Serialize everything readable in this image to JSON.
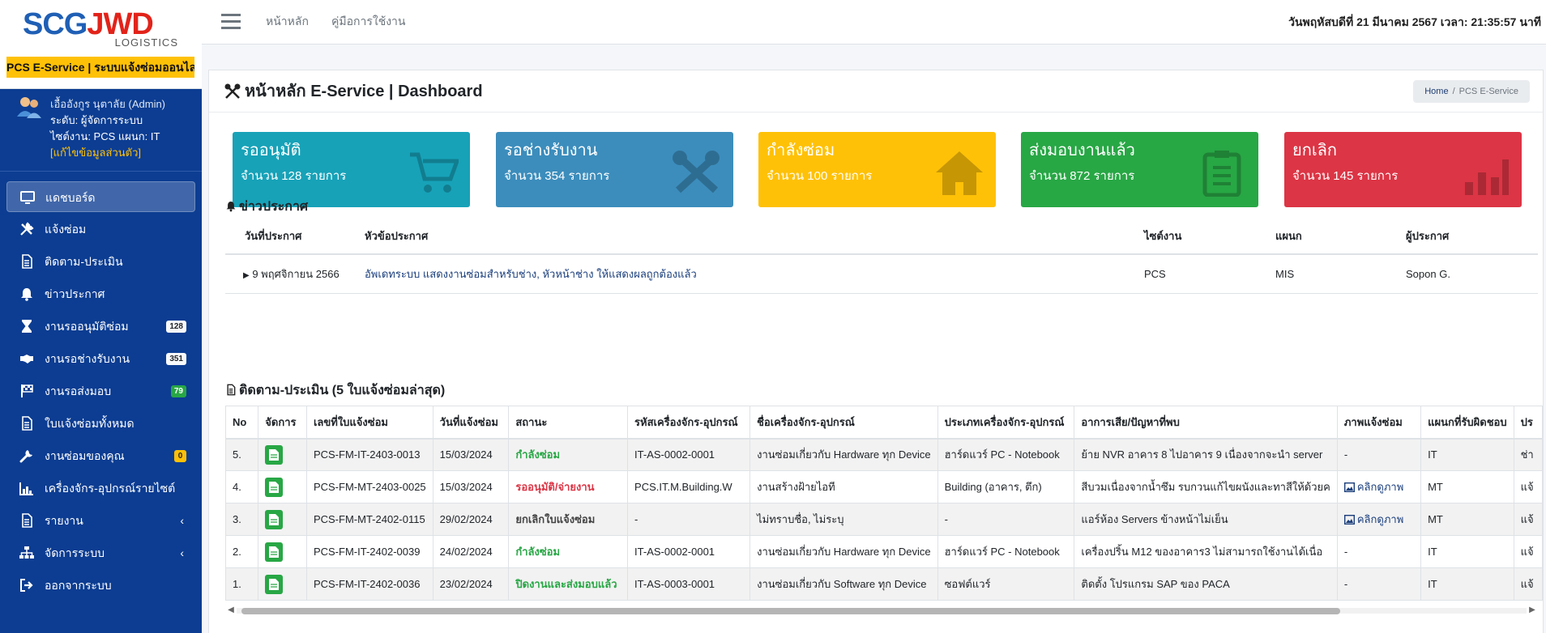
{
  "brand": {
    "logo_text_left": "SCG",
    "logo_text_right": "JWD",
    "logo_sub": "LOGISTICS",
    "band": "PCS E-Service | ระบบแจ้งซ่อมออนไลน์"
  },
  "user": {
    "name": "เอื้ออังกูร นุตาลัย (Admin)",
    "level": "ระดับ: ผู้จัดการระบบ",
    "site": "ไซต์งาน: PCS แผนก: IT",
    "edit_link": "[แก้ไขข้อมูลส่วนตัว]"
  },
  "nav": {
    "items": [
      {
        "label": "แดชบอร์ด",
        "icon": "desktop-icon"
      },
      {
        "label": "แจ้งซ่อม",
        "icon": "tools-icon"
      },
      {
        "label": "ติดตาม-ประเมิน",
        "icon": "file-icon"
      },
      {
        "label": "ข่าวประกาศ",
        "icon": "bell-icon"
      },
      {
        "label": "งานรออนุมัติซ่อม",
        "icon": "hourglass-icon",
        "badge": "128"
      },
      {
        "label": "งานรอช่างรับงาน",
        "icon": "handshake-icon",
        "badge": "351"
      },
      {
        "label": "งานรอส่งมอบ",
        "icon": "flag-icon",
        "badge": "79"
      },
      {
        "label": "ใบแจ้งซ่อมทั้งหมด",
        "icon": "file-icon"
      },
      {
        "label": "งานซ่อมของคุณ",
        "icon": "wrench-icon",
        "badge": "0"
      },
      {
        "label": "เครื่องจักร-อุปกรณ์รายไซต์",
        "icon": "chart-icon"
      },
      {
        "label": "รายงาน",
        "icon": "file-icon",
        "chevron": "‹"
      },
      {
        "label": "จัดการระบบ",
        "icon": "sitemap-icon",
        "chevron": "‹"
      },
      {
        "label": "ออกจากระบบ",
        "icon": "signout-icon"
      }
    ]
  },
  "topbar": {
    "home_link": "หน้าหลัก",
    "manual_link": "คู่มือการใช้งาน",
    "datetime": "วันพฤหัสบดีที่ 21 มีนาคม 2567 เวลา: 21:35:57 นาที"
  },
  "page": {
    "title": "หน้าหลัก E-Service | Dashboard",
    "breadcrumb_home": "Home",
    "breadcrumb_sep": "/",
    "breadcrumb_current": "PCS E-Service"
  },
  "stats": [
    {
      "title": "รออนุมัติ",
      "count": "จำนวน 128 รายการ",
      "color": "#17a2b8",
      "icon": "cart-icon"
    },
    {
      "title": "รอช่างรับงาน",
      "count": "จำนวน 354 รายการ",
      "color": "#3c8dbc",
      "icon": "tools-icon"
    },
    {
      "title": "กำลังซ่อม",
      "count": "จำนวน 100 รายการ",
      "color": "#ffc107",
      "icon": "home-icon"
    },
    {
      "title": "ส่งมอบงานแล้ว",
      "count": "จำนวน 872 รายการ",
      "color": "#28a745",
      "icon": "clipboard-icon"
    },
    {
      "title": "ยกเลิก",
      "count": "จำนวน 145 รายการ",
      "color": "#dc3545",
      "icon": "bar-chart-icon"
    }
  ],
  "announcements": {
    "title": "ข่าวประกาศ",
    "headers": [
      "วันที่ประกาศ",
      "หัวข้อประกาศ",
      "ไซต์งาน",
      "แผนก",
      "ผู้ประกาศ"
    ],
    "rows": [
      {
        "date": "9 พฤศจิกายน 2566",
        "topic": "อัพเดทระบบ แสดงงานซ่อมสำหรับช่าง, หัวหน้าช่าง ให้แสดงผลถูกต้องแล้ว",
        "site": "PCS",
        "dept": "MIS",
        "author": "Sopon G."
      }
    ]
  },
  "tracking": {
    "title": "ติดตาม-ประเมิน (5 ใบแจ้งซ่อมล่าสุด)",
    "headers": [
      "No",
      "จัดการ",
      "เลขที่ใบแจ้งซ่อม",
      "วันที่แจ้งซ่อม",
      "สถานะ",
      "รหัสเครื่องจักร-อุปกรณ์",
      "ชื่อเครื่องจักร-อุปกรณ์",
      "ประเภทเครื่องจักร-อุปกรณ์",
      "อาการเสีย/ปัญหาที่พบ",
      "ภาพแจ้งซ่อม",
      "แผนกที่รับผิดชอบ",
      "ปร"
    ],
    "rows": [
      {
        "no": "5.",
        "ticket": "PCS-FM-IT-2403-0013",
        "date": "15/03/2024",
        "status": "กำลังซ่อม",
        "status_color": "#28a745",
        "code": "IT-AS-0002-0001",
        "name": "งานซ่อมเกี่ยวกับ Hardware ทุก Device",
        "type": "ฮาร์ดแวร์ PC - Notebook",
        "issue": "ย้าย NVR อาคาร 8 ไปอาคาร 9 เนื่องจากจะนำ server",
        "image": "-",
        "dept": "IT",
        "extra": "ช่า"
      },
      {
        "no": "4.",
        "ticket": "PCS-FM-MT-2403-0025",
        "date": "15/03/2024",
        "status": "รออนุมัติ/จ่ายงาน",
        "status_color": "#dc3545",
        "code": "PCS.IT.M.Building.W",
        "name": "งานสร้างฝ้ายไอที",
        "type": "Building (อาคาร, ตึก)",
        "issue": "สีบวมเนื่องจากน้ำซึม รบกวนแก้ไขผนังและทาสีให้ด้วยค",
        "image": "คลิกดูภาพ",
        "dept": "MT",
        "extra": "แจ้"
      },
      {
        "no": "3.",
        "ticket": "PCS-FM-MT-2402-0115",
        "date": "29/02/2024",
        "status": "ยกเลิกใบแจ้งซ่อม",
        "status_color": "#444444",
        "code": "-",
        "name": "ไม่ทราบชื่อ, ไม่ระบุ",
        "type": "-",
        "issue": "แอร์ห้อง Servers ข้างหน้าไม่เย็น",
        "image": "คลิกดูภาพ",
        "dept": "MT",
        "extra": "แจ้"
      },
      {
        "no": "2.",
        "ticket": "PCS-FM-IT-2402-0039",
        "date": "24/02/2024",
        "status": "กำลังซ่อม",
        "status_color": "#28a745",
        "code": "IT-AS-0002-0001",
        "name": "งานซ่อมเกี่ยวกับ Hardware ทุก Device",
        "type": "ฮาร์ดแวร์ PC - Notebook",
        "issue": "เครื่องปริ้น M12 ของอาคาร3 ไม่สามารถใช้งานได้เนื่อ",
        "image": "-",
        "dept": "IT",
        "extra": "แจ้"
      },
      {
        "no": "1.",
        "ticket": "PCS-FM-IT-2402-0036",
        "date": "23/02/2024",
        "status": "ปิดงานและส่งมอบแล้ว",
        "status_color": "#28a745",
        "code": "IT-AS-0003-0001",
        "name": "งานซ่อมเกี่ยวกับ Software ทุก Device",
        "type": "ซอฟต์แวร์",
        "issue": "ติดตั้ง โปรแกรม SAP ของ PACA",
        "image": "-",
        "dept": "IT",
        "extra": "แจ้"
      }
    ]
  },
  "scroll": {
    "left_arrow": "◀",
    "right_arrow": "▶"
  }
}
